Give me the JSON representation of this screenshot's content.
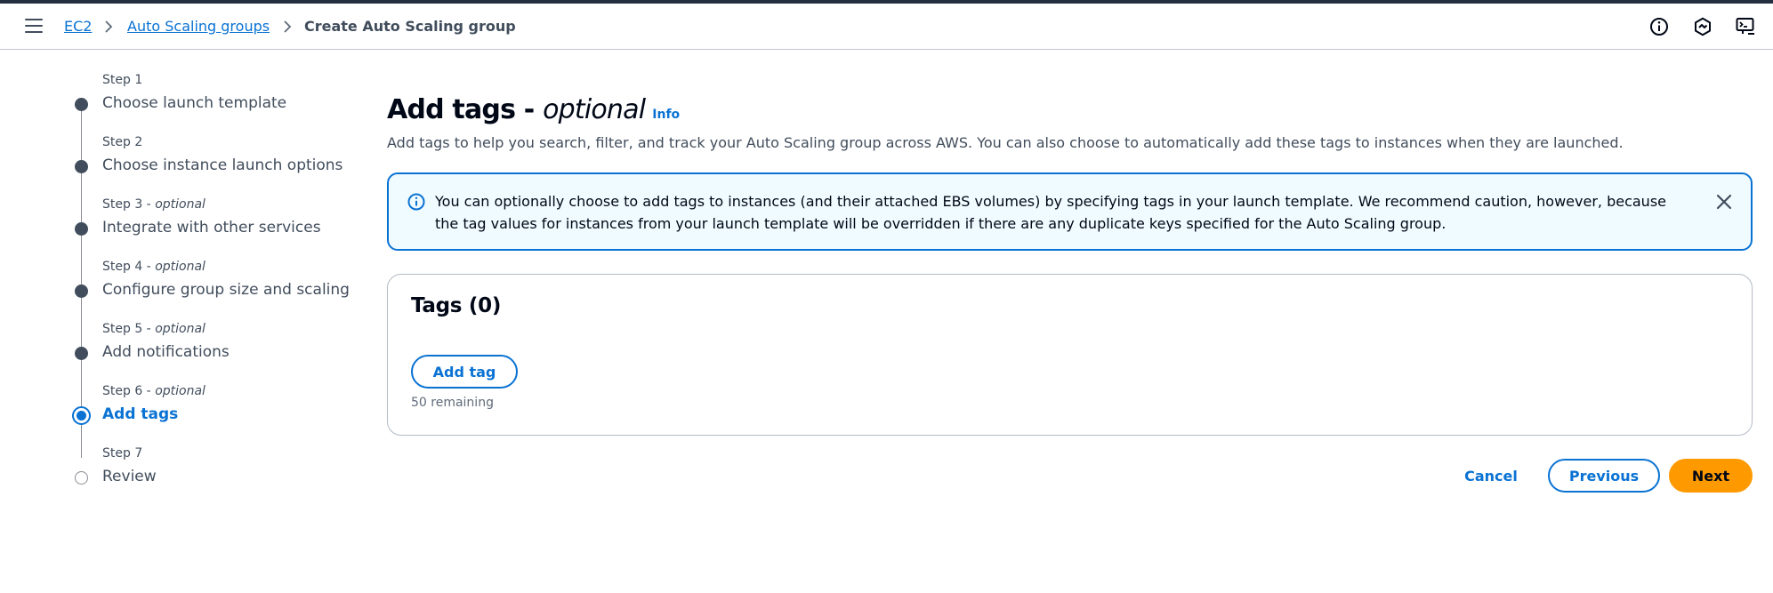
{
  "breadcrumb": {
    "items": [
      "EC2",
      "Auto Scaling groups"
    ],
    "current": "Create Auto Scaling group"
  },
  "topbar_icons": [
    "info-circle-icon",
    "settings-hexagon-icon",
    "cloudshell-icon"
  ],
  "steps": [
    {
      "number": "Step 1",
      "optional": "",
      "title": "Choose launch template",
      "state": "complete"
    },
    {
      "number": "Step 2",
      "optional": "",
      "title": "Choose instance launch options",
      "state": "complete"
    },
    {
      "number": "Step 3",
      "optional": "optional",
      "title": "Integrate with other services",
      "state": "complete"
    },
    {
      "number": "Step 4",
      "optional": "optional",
      "title": "Configure group size and scaling",
      "state": "complete"
    },
    {
      "number": "Step 5",
      "optional": "optional",
      "title": "Add notifications",
      "state": "complete"
    },
    {
      "number": "Step 6",
      "optional": "optional",
      "title": "Add tags",
      "state": "current"
    },
    {
      "number": "Step 7",
      "optional": "",
      "title": "Review",
      "state": "pending"
    }
  ],
  "step_separator": " - ",
  "header": {
    "title": "Add tags - ",
    "title_optional": "optional",
    "info_link": "Info",
    "description": "Add tags to help you search, filter, and track your Auto Scaling group across AWS. You can also choose to automatically add these tags to instances when they are launched."
  },
  "alert": {
    "text": "You can optionally choose to add tags to instances (and their attached EBS volumes) by specifying tags in your launch template. We recommend caution, however, because the tag values for instances from your launch template will be overridden if there are any duplicate keys specified for the Auto Scaling group."
  },
  "tags_panel": {
    "title": "Tags (0)",
    "add_button": "Add tag",
    "remaining": "50 remaining"
  },
  "footer": {
    "cancel": "Cancel",
    "previous": "Previous",
    "next": "Next"
  },
  "colors": {
    "link": "#0972d3",
    "primary_button": "#ff9900",
    "alert_bg": "#f0fbff",
    "text": "#000716"
  }
}
